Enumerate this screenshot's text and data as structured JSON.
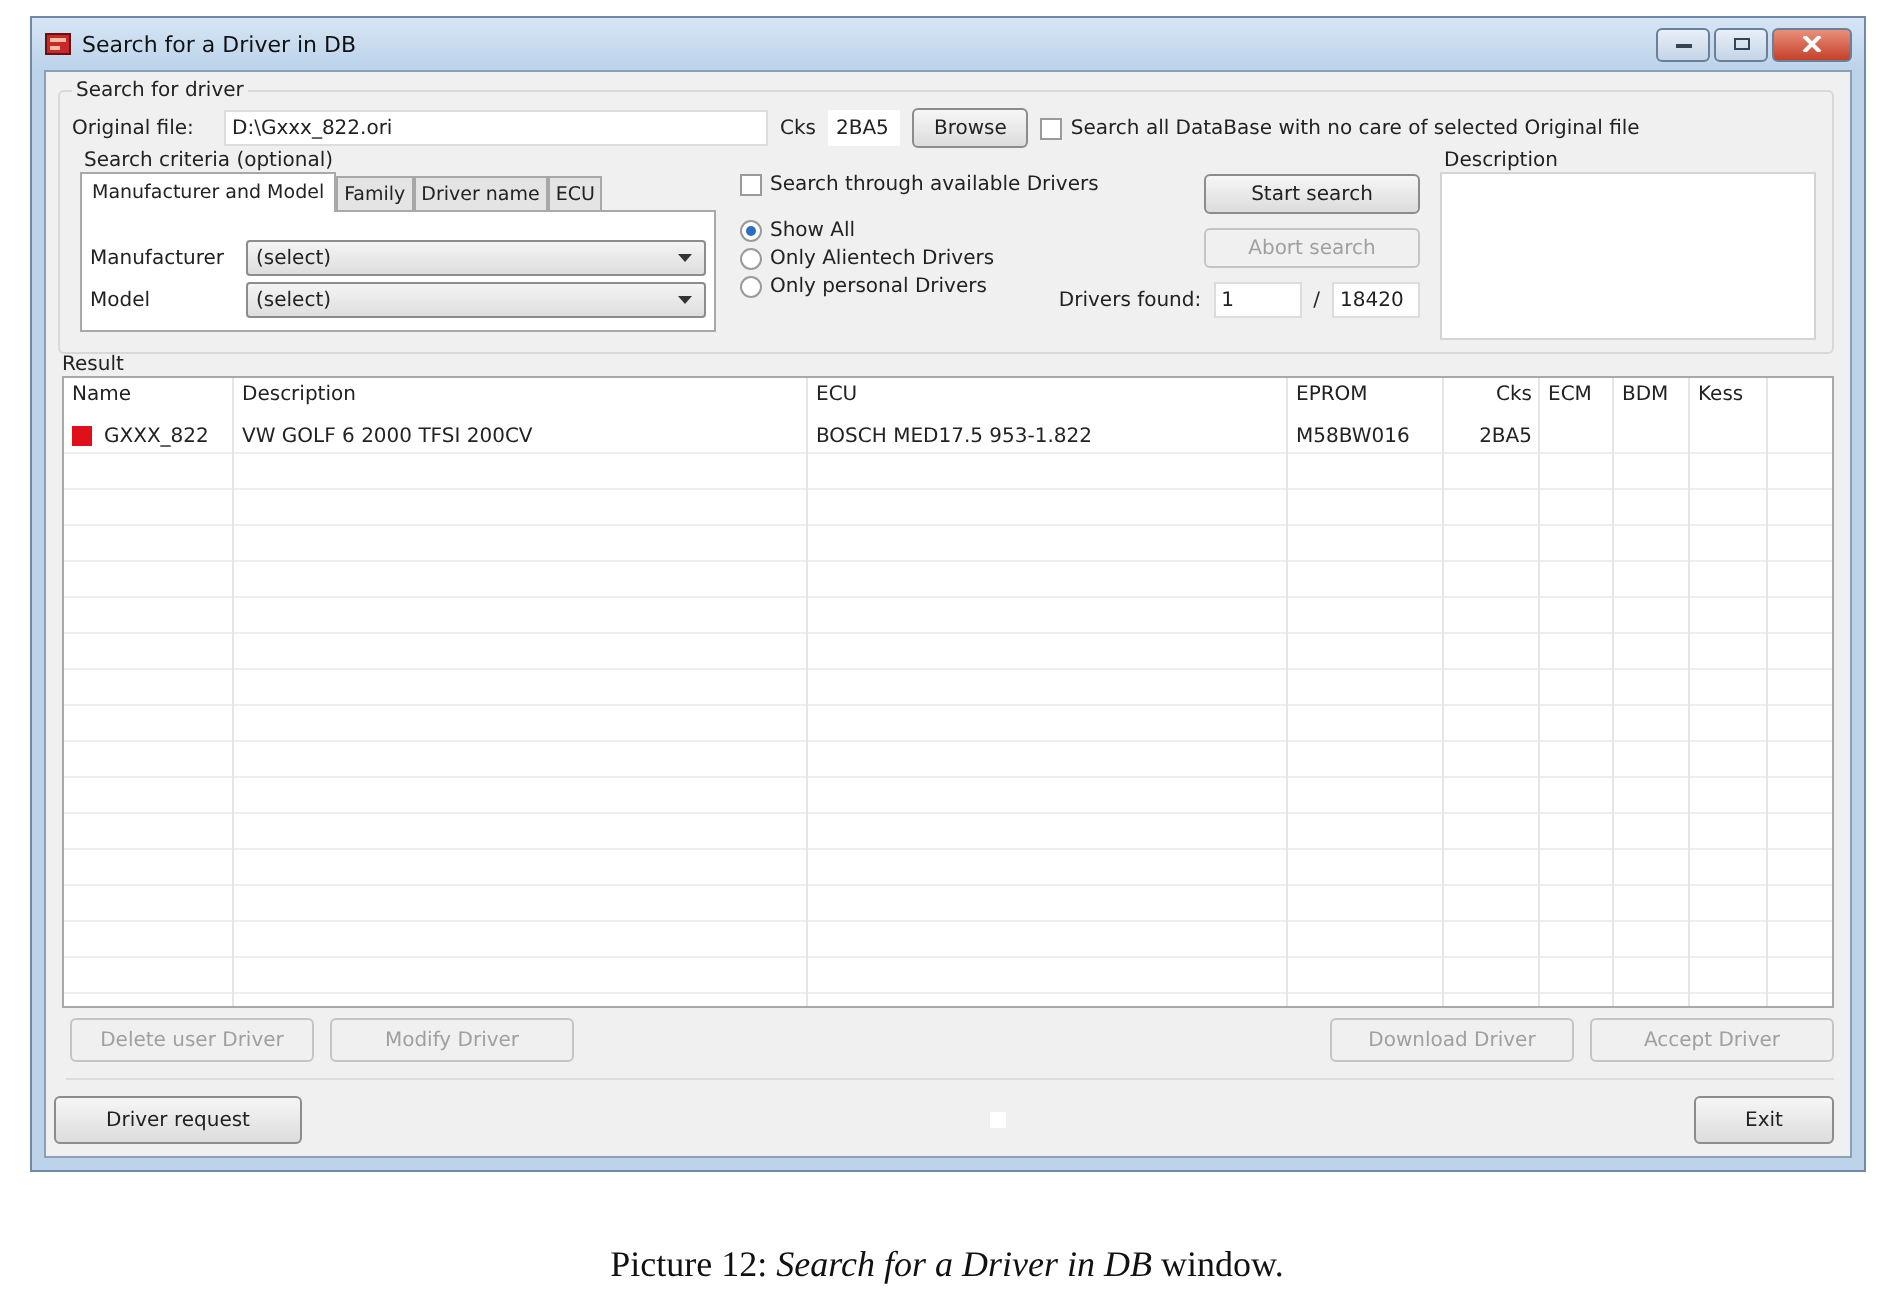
{
  "window": {
    "title": "Search for a Driver in DB"
  },
  "search_for_driver": {
    "legend": "Search for driver",
    "original_file": {
      "label": "Original file:",
      "value": "D:\\Gxxx_822.ori"
    },
    "cks": {
      "label": "Cks",
      "value": "2BA5"
    },
    "browse_button": "Browse",
    "search_all": {
      "label": "Search all DataBase with no care of selected Original file",
      "checked": false
    }
  },
  "search_criteria": {
    "legend": "Search criteria (optional)",
    "tabs": [
      {
        "label": "Manufacturer and Model",
        "selected": true
      },
      {
        "label": "Family",
        "selected": false
      },
      {
        "label": "Driver name",
        "selected": false
      },
      {
        "label": "ECU",
        "selected": false
      }
    ],
    "fields": [
      {
        "label": "Manufacturer",
        "value": "(select)"
      },
      {
        "label": "Model",
        "value": "(select)"
      }
    ]
  },
  "search_available": {
    "label": "Search through available Drivers",
    "checked": false
  },
  "radio_options": [
    {
      "label": "Show All",
      "selected": true
    },
    {
      "label": "Only Alientech Drivers",
      "selected": false
    },
    {
      "label": "Only personal Drivers",
      "selected": false
    }
  ],
  "start_button": {
    "label": "Start search",
    "disabled": false
  },
  "abort_button": {
    "label": "Abort search",
    "disabled": true
  },
  "drivers_found": {
    "label": "Drivers found:",
    "count": "1",
    "separator": "/",
    "total": "18420"
  },
  "description": {
    "legend": "Description"
  },
  "result": {
    "legend": "Result",
    "columns": [
      "Name",
      "Description",
      "ECU",
      "EPROM",
      "Cks",
      "ECM",
      "BDM",
      "Kess"
    ],
    "rows": [
      {
        "color": "#e0101a",
        "cells": [
          "GXXX_822",
          "VW GOLF 6 2000 TFSI 200CV",
          "BOSCH MED17.5 953-1.822",
          "M58BW016",
          "2BA5",
          "",
          "",
          ""
        ]
      }
    ]
  },
  "action_buttons": [
    {
      "label": "Delete user Driver",
      "disabled": true
    },
    {
      "label": "Modify Driver",
      "disabled": true
    },
    {
      "label": "Download Driver",
      "disabled": true
    },
    {
      "label": "Accept Driver",
      "disabled": true
    }
  ],
  "driver_request_button": "Driver request",
  "exit_button": "Exit",
  "caption": "Picture 12: *Search for a Driver in DB* window."
}
